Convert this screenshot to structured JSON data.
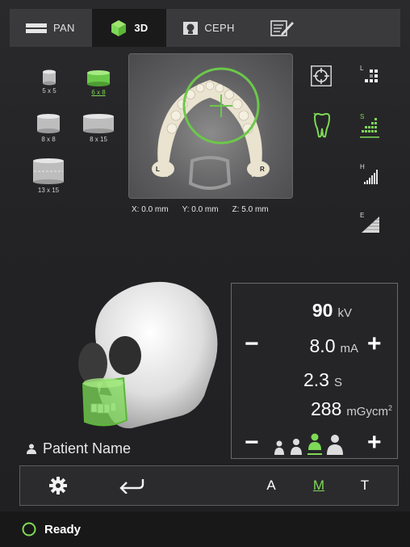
{
  "tabs": [
    {
      "label": "PAN",
      "icon": "pan-icon"
    },
    {
      "label": "3D",
      "icon": "cube-icon"
    },
    {
      "label": "CEPH",
      "icon": "ceph-icon"
    },
    {
      "label": "",
      "icon": "report-edit-icon"
    }
  ],
  "fov": {
    "items": [
      {
        "label": "5 x 5"
      },
      {
        "label": "6 x 8"
      },
      {
        "label": "8 x 8"
      },
      {
        "label": "8 x 15"
      },
      {
        "label": "13 x 15"
      }
    ],
    "selected": "6 x 8"
  },
  "xray": {
    "left_marker": "L",
    "right_marker": "R"
  },
  "coords": {
    "x": "X: 0.0 mm",
    "y": "Y: 0.0 mm",
    "z": "Z: 5.0 mm"
  },
  "resolution": {
    "items": [
      "L",
      "S",
      "H",
      "E"
    ],
    "selected": "S"
  },
  "params": {
    "kv_value": "90",
    "kv_unit": "kV",
    "ma_value": "8.0",
    "ma_unit": "mA",
    "time_value": "2.3",
    "time_unit": "S",
    "dose_value": "288",
    "dose_unit": "mGycm",
    "dose_sup": "2"
  },
  "patient": {
    "name": "Patient Name"
  },
  "toolbar": {
    "mode_a": "A",
    "mode_m": "M",
    "mode_t": "T",
    "selected_mode": "M"
  },
  "status": {
    "text": "Ready"
  },
  "colors": {
    "accent": "#7ed957",
    "background": "#232325",
    "tab_bar": "#3a3a3d"
  }
}
